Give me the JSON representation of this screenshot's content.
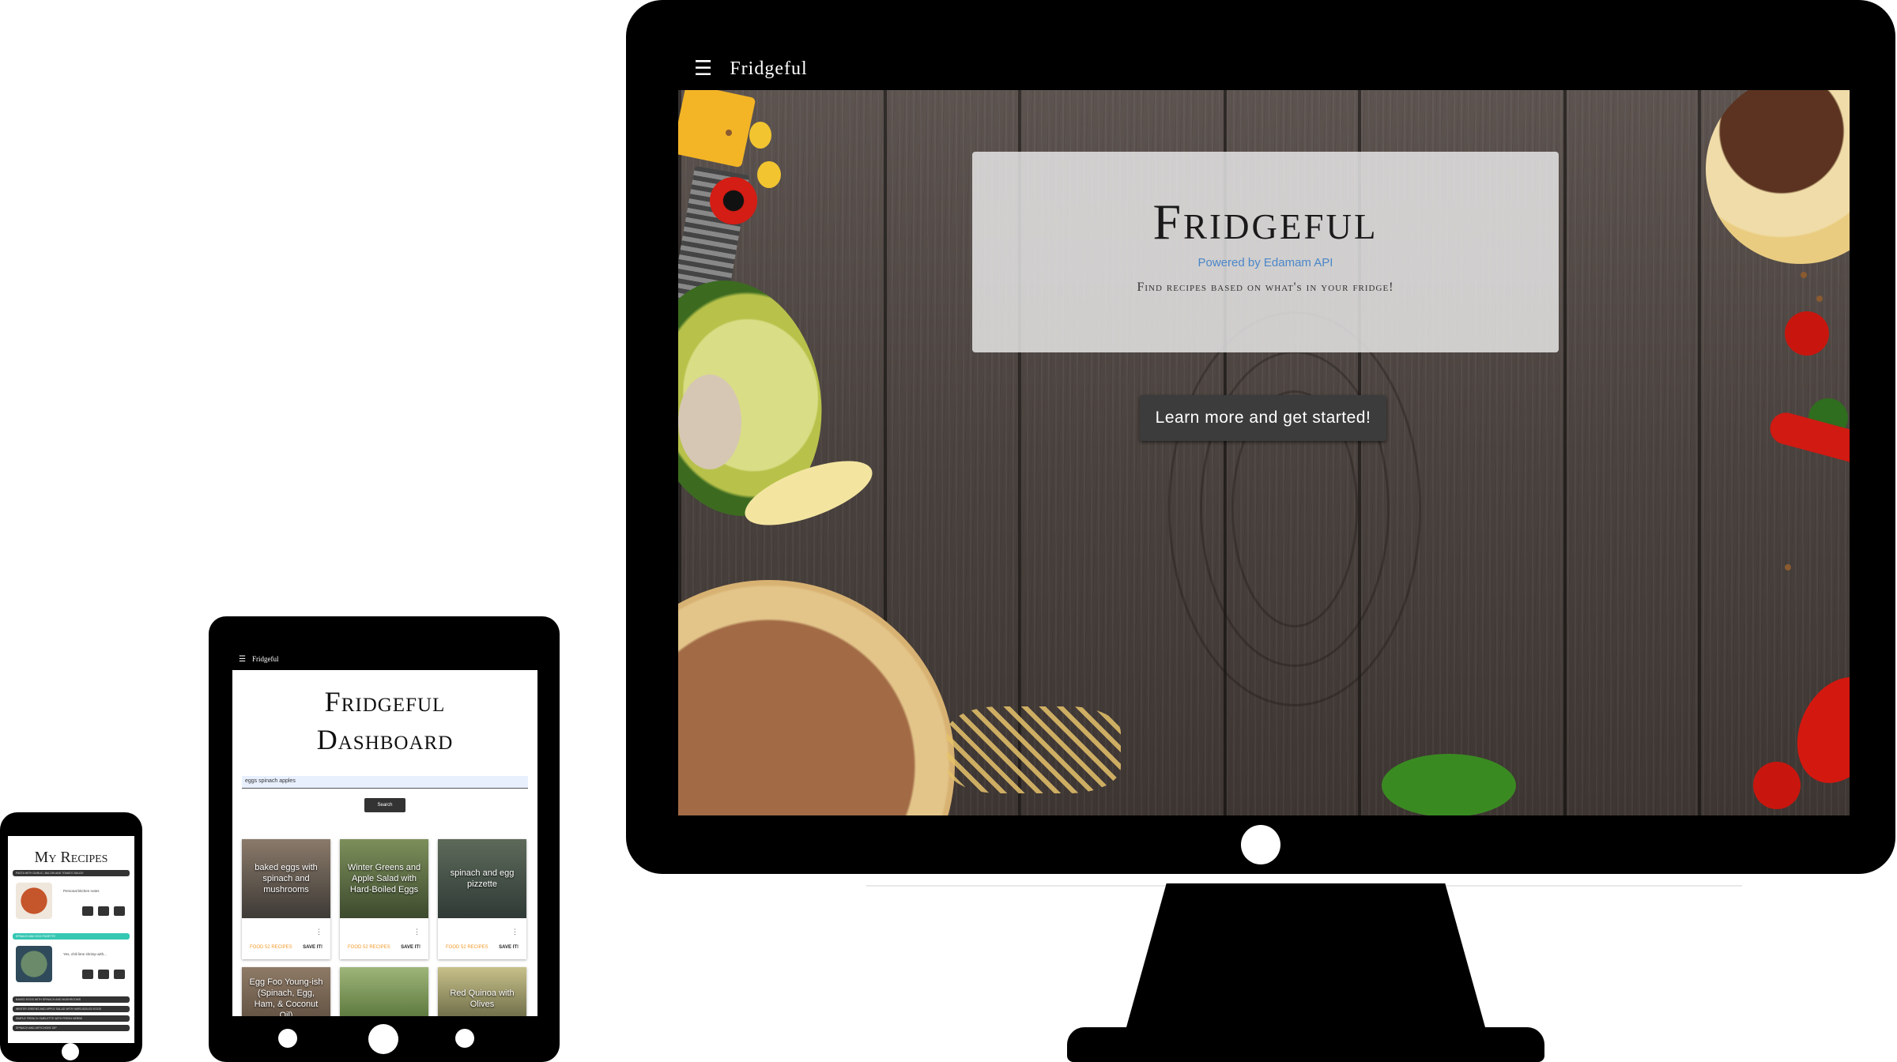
{
  "desktop": {
    "app_name": "Fridgeful",
    "menu_icon": "hamburger-menu-icon",
    "hero": {
      "title": "Fridgeful",
      "powered_by": "Powered by Edamam API",
      "tagline": "Find recipes based on what's in your fridge!",
      "cta_label": "Learn more and get started!"
    }
  },
  "tablet": {
    "app_name": "Fridgeful",
    "title_line1": "Fridgeful",
    "title_line2": "Dashboard",
    "search_value": "eggs spinach apples",
    "search_button": "Search",
    "cards": [
      {
        "title": "baked eggs with spinach and mushrooms",
        "source": "FOOD 52 RECIPES",
        "save": "SAVE IT!"
      },
      {
        "title": "Winter Greens and Apple Salad with Hard-Boiled Eggs",
        "source": "FOOD 52 RECIPES",
        "save": "SAVE IT!"
      },
      {
        "title": "spinach and egg pizzette",
        "source": "FOOD 52 RECIPES",
        "save": "SAVE IT!"
      },
      {
        "title": "Egg Foo Young-ish (Spinach, Egg, Ham, & Coconut Oil)",
        "source": "",
        "save": ""
      },
      {
        "title": "",
        "source": "",
        "save": ""
      },
      {
        "title": "Red Quinoa with Olives",
        "source": "",
        "save": ""
      }
    ]
  },
  "phone": {
    "title": "My Recipes",
    "bars": [
      "PASTA WITH GARLIC, BACON AND TOMATO SAUCE",
      "SPINACH AND EGG PIZZETTE"
    ],
    "items": [
      {
        "text": "Personal kitchen notes"
      },
      {
        "text": "Yes, chili lime shrimp with..."
      }
    ],
    "bottom_bars": [
      "BAKED EGGS WITH SPINACH AND MUSHROOMS",
      "WINTER GREENS AND APPLE SALAD WITH HARD-BOILED EGGS",
      "SIMPLE FRENCH OMELETTE WITH FRESH HERBS",
      "SPINACH AND ARTICHOKE DIP"
    ]
  },
  "colors": {
    "accent_blue": "#4a86c9",
    "teal": "#36c7b3",
    "orange": "#f39a2a",
    "dark_button": "#3c3c3c"
  }
}
